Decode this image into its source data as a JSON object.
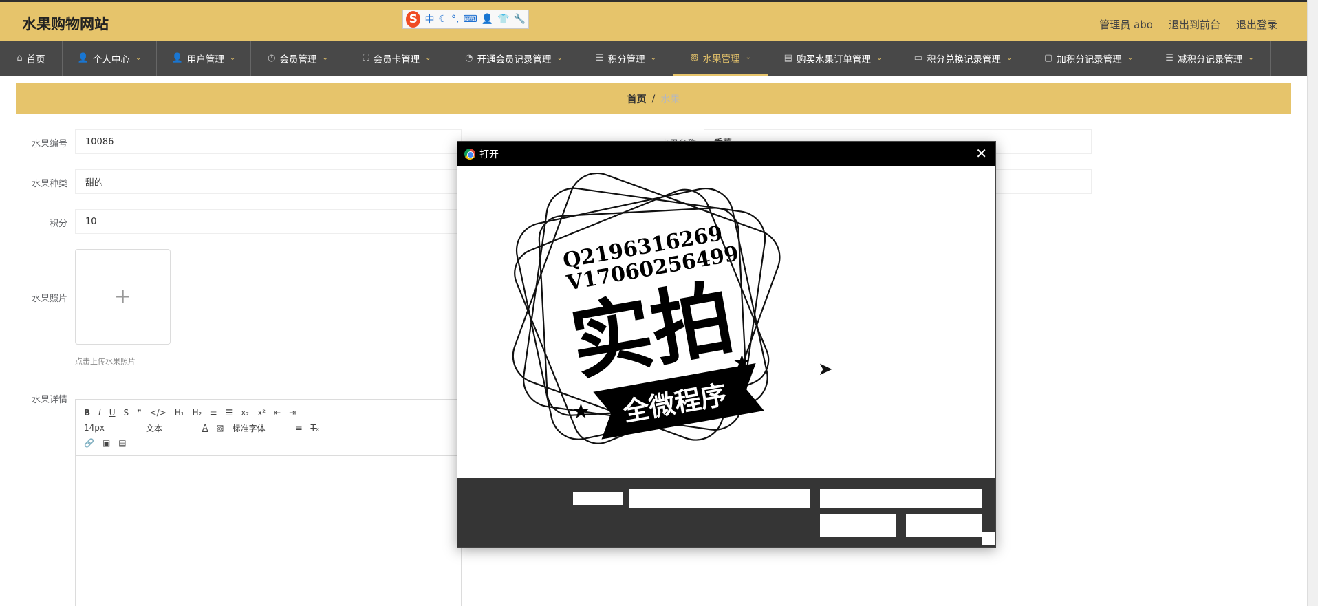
{
  "site": {
    "title": "水果购物网站"
  },
  "ime": {
    "chars": [
      "中",
      "☾",
      "°,",
      "⌨",
      "👤",
      "👕",
      "🔧"
    ]
  },
  "header": {
    "admin": "管理员 abo",
    "front": "退出到前台",
    "logout": "退出登录"
  },
  "nav": [
    {
      "label": "首页",
      "icon": "home-icon",
      "glyph": "⌂"
    },
    {
      "label": "个人中心",
      "icon": "person-icon",
      "glyph": "👤"
    },
    {
      "label": "用户管理",
      "icon": "person-icon",
      "glyph": "👤"
    },
    {
      "label": "会员管理",
      "icon": "clock-icon",
      "glyph": "◷"
    },
    {
      "label": "会员卡管理",
      "icon": "frame-icon",
      "glyph": "⛶"
    },
    {
      "label": "开通会员记录管理",
      "icon": "gauge-icon",
      "glyph": "◔"
    },
    {
      "label": "积分管理",
      "icon": "list-icon",
      "glyph": "☰"
    },
    {
      "label": "水果管理",
      "icon": "chart-icon",
      "glyph": "▨",
      "active": true
    },
    {
      "label": "购买水果订单管理",
      "icon": "bag-icon",
      "glyph": "▤"
    },
    {
      "label": "积分兑换记录管理",
      "icon": "image-icon",
      "glyph": "▭"
    },
    {
      "label": "加积分记录管理",
      "icon": "chat-icon",
      "glyph": "▢"
    },
    {
      "label": "减积分记录管理",
      "icon": "list-icon",
      "glyph": "☰"
    }
  ],
  "breadcrumb": {
    "home": "首页",
    "sep": "/",
    "current": "水果"
  },
  "form": {
    "code_label": "水果编号",
    "code_value": "10086",
    "name_label": "水果名称",
    "name_value": "香蕉",
    "type_label": "水果种类",
    "type_value": "甜的",
    "points_label": "积分",
    "points_value": "10",
    "photo_label": "水果照片",
    "photo_tip": "点击上传水果照片",
    "detail_label": "水果详情"
  },
  "editor": {
    "font_size": "14px",
    "block": "文本",
    "font": "标准字体"
  },
  "dialog": {
    "title": "打开",
    "stamp": {
      "line1": "Q2196316269",
      "line2": "V17060256499",
      "big": "实拍",
      "banner": "全微程序"
    }
  }
}
